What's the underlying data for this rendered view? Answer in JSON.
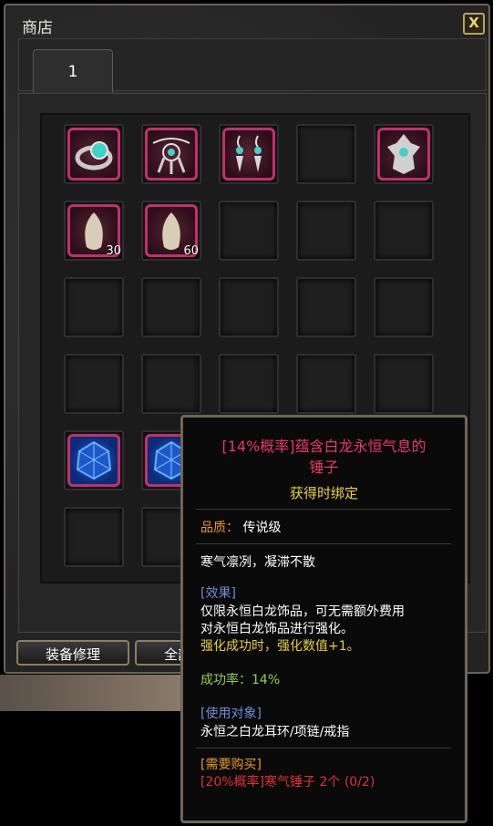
{
  "window": {
    "title": "商店",
    "close_label": "X"
  },
  "tabs": [
    {
      "label": "1"
    }
  ],
  "items": [
    {
      "name": "ring",
      "qty": ""
    },
    {
      "name": "dreamcatcher-necklace",
      "qty": ""
    },
    {
      "name": "earrings",
      "qty": ""
    },
    {
      "name": "empty",
      "qty": ""
    },
    {
      "name": "emblem",
      "qty": ""
    },
    {
      "name": "crystal-shard",
      "qty": "30"
    },
    {
      "name": "crystal-shard",
      "qty": "60"
    },
    {
      "name": "blue-gem",
      "qty": ""
    },
    {
      "name": "blue-gem",
      "qty": ""
    }
  ],
  "buttons": {
    "repair": "装备修理",
    "repair_all": "全部修理"
  },
  "tooltip": {
    "title_line1": "[14%概率]蕴含白龙永恒气息的",
    "title_line2": "锤子",
    "bind": "获得时绑定",
    "quality_label": "品质：",
    "quality_value": "传说级",
    "flavor": "寒气凛冽，凝滞不散",
    "effect_header": "[效果]",
    "effect_line1": "仅限永恒白龙饰品，可无需额外费用",
    "effect_line2": "对永恒白龙饰品进行强化。",
    "effect_line3": "强化成功时，强化数值+1。",
    "success_rate": "成功率：14%",
    "target_header": "[使用对象]",
    "target_value": "永恒之白龙耳环/项链/戒指",
    "purchase_header": "[需要购买]",
    "purchase_value": "[20%概率]寒气锤子 2个 (0/2)"
  },
  "colors": {
    "item_border": "#c2306a",
    "title_red": "#e8376a",
    "bind_yellow": "#e8d13a",
    "header_blue": "#6f8fd6",
    "success_green": "#8ed14a",
    "purchase_orange": "#e89a2a",
    "purchase_red": "#e23030"
  }
}
